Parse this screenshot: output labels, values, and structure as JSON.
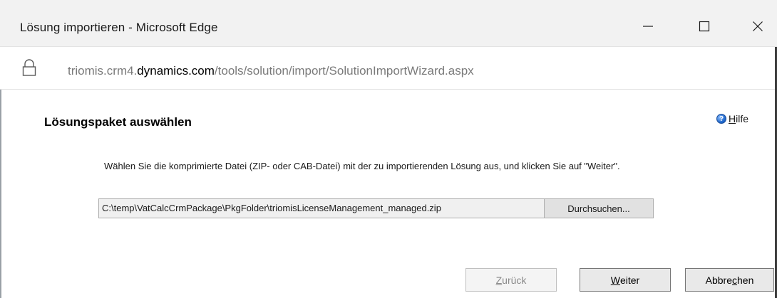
{
  "window": {
    "title": "Lösung importieren - Microsoft Edge",
    "minimize_icon": "minimize-icon",
    "maximize_icon": "maximize-icon",
    "close_icon": "close-icon"
  },
  "address_bar": {
    "lock_icon": "lock-icon",
    "url_prefix": "triomis.crm4.",
    "url_domain": "dynamics.com",
    "url_path": "/tools/solution/import/SolutionImportWizard.aspx"
  },
  "page": {
    "title": "Lösungspaket auswählen",
    "help": {
      "icon": "help-icon",
      "access_key": "H",
      "label_rest": "ilfe"
    },
    "instructions": "Wählen Sie die komprimierte Datei (ZIP- oder CAB-Datei) mit der zu importierenden Lösung aus, und klicken Sie auf \"Weiter\"."
  },
  "file_picker": {
    "value": "C:\\temp\\VatCalcCrmPackage\\PkgFolder\\triomisLicenseManagement_managed.zip",
    "browse_label": "Durchsuchen..."
  },
  "buttons": {
    "back": {
      "access_key": "Z",
      "label_rest": "urück",
      "enabled": false
    },
    "next": {
      "access_key": "W",
      "label_rest": "eiter",
      "enabled": true
    },
    "cancel": {
      "label_before": "Abbre",
      "access_key": "c",
      "label_after": "hen",
      "enabled": true
    }
  },
  "colors": {
    "titlebar_bg": "#f2f2f2",
    "url_gray": "#7a7a7a",
    "help_blue": "#1a63c9",
    "disabled_text": "#8a8a8a"
  }
}
